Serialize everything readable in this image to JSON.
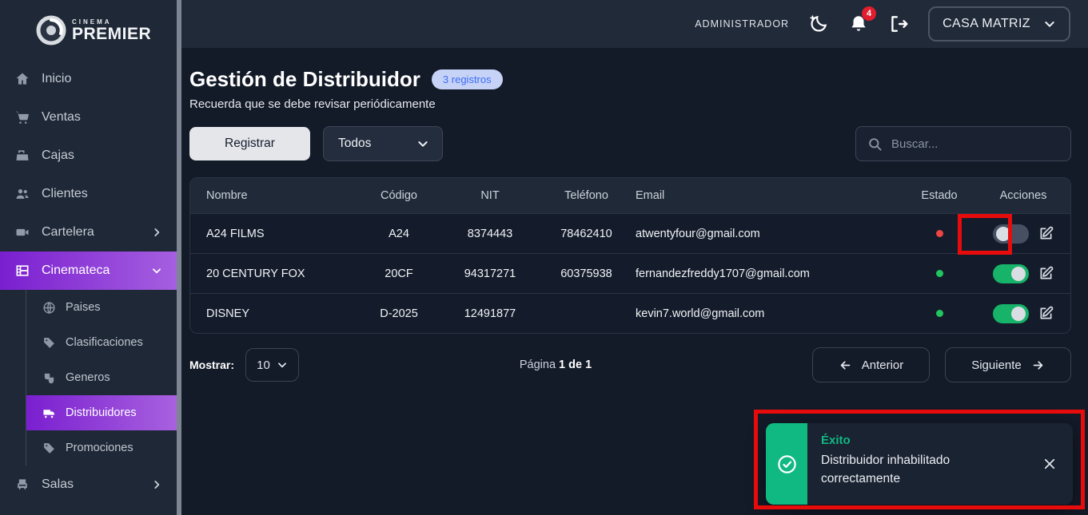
{
  "brand": {
    "top": "CINEMA",
    "name": "PREMIER"
  },
  "topbar": {
    "role_label": "ADMINISTRADOR",
    "notification_count": "4",
    "branch": "CASA MATRIZ"
  },
  "page": {
    "title": "Gestión de Distribuidor",
    "records_badge": "3 registros",
    "subtitle": "Recuerda que se debe revisar periódicamente"
  },
  "toolbar": {
    "register": "Registrar",
    "filter_value": "Todos",
    "search_placeholder": "Buscar..."
  },
  "sidebar": {
    "items": [
      {
        "label": "Inicio",
        "icon": "home-icon"
      },
      {
        "label": "Ventas",
        "icon": "cart-icon"
      },
      {
        "label": "Cajas",
        "icon": "cash-register-icon"
      },
      {
        "label": "Clientes",
        "icon": "users-icon"
      },
      {
        "label": "Cartelera",
        "icon": "video-camera-icon",
        "chevron": "right"
      },
      {
        "label": "Cinemateca",
        "icon": "film-icon",
        "chevron": "down",
        "active": true
      }
    ],
    "submenu": [
      {
        "label": "Paises",
        "icon": "globe-icon"
      },
      {
        "label": "Clasificaciones",
        "icon": "tag-icon"
      },
      {
        "label": "Generos",
        "icon": "masks-icon"
      },
      {
        "label": "Distribuidores",
        "icon": "truck-icon",
        "active": true
      },
      {
        "label": "Promociones",
        "icon": "tag-icon"
      }
    ],
    "footer_item": {
      "label": "Salas",
      "icon": "seat-icon",
      "chevron": "right"
    }
  },
  "table": {
    "headers": {
      "nombre": "Nombre",
      "codigo": "Código",
      "nit": "NIT",
      "telefono": "Teléfono",
      "email": "Email",
      "estado": "Estado",
      "acciones": "Acciones"
    },
    "rows": [
      {
        "nombre": "A24 FILMS",
        "codigo": "A24",
        "nit": "8374443",
        "telefono": "78462410",
        "email": "atwentyfour@gmail.com",
        "estado": "inactive",
        "toggle": "off"
      },
      {
        "nombre": "20 CENTURY FOX",
        "codigo": "20CF",
        "nit": "94317271",
        "telefono": "60375938",
        "email": "fernandezfreddy1707@gmail.com",
        "estado": "active",
        "toggle": "on"
      },
      {
        "nombre": "DISNEY",
        "codigo": "D-2025",
        "nit": "12491877",
        "telefono": "",
        "email": "kevin7.world@gmail.com",
        "estado": "active",
        "toggle": "on"
      }
    ]
  },
  "pagination": {
    "show_label": "Mostrar:",
    "page_size": "10",
    "page_word": "Página ",
    "page_info": "1 de 1",
    "prev": "Anterior",
    "next": "Siguiente"
  },
  "toast": {
    "title": "Éxito",
    "message": "Distribuidor inhabilitado correctamente"
  },
  "colors": {
    "accent_purple": "#8b31d9",
    "success_green": "#10b981",
    "danger_red": "#ef4444",
    "toggle_on": "#16b369",
    "badge_bg": "#c7d3f6",
    "badge_text": "#3b6cf5",
    "annotation_red": "#e80b0b"
  }
}
